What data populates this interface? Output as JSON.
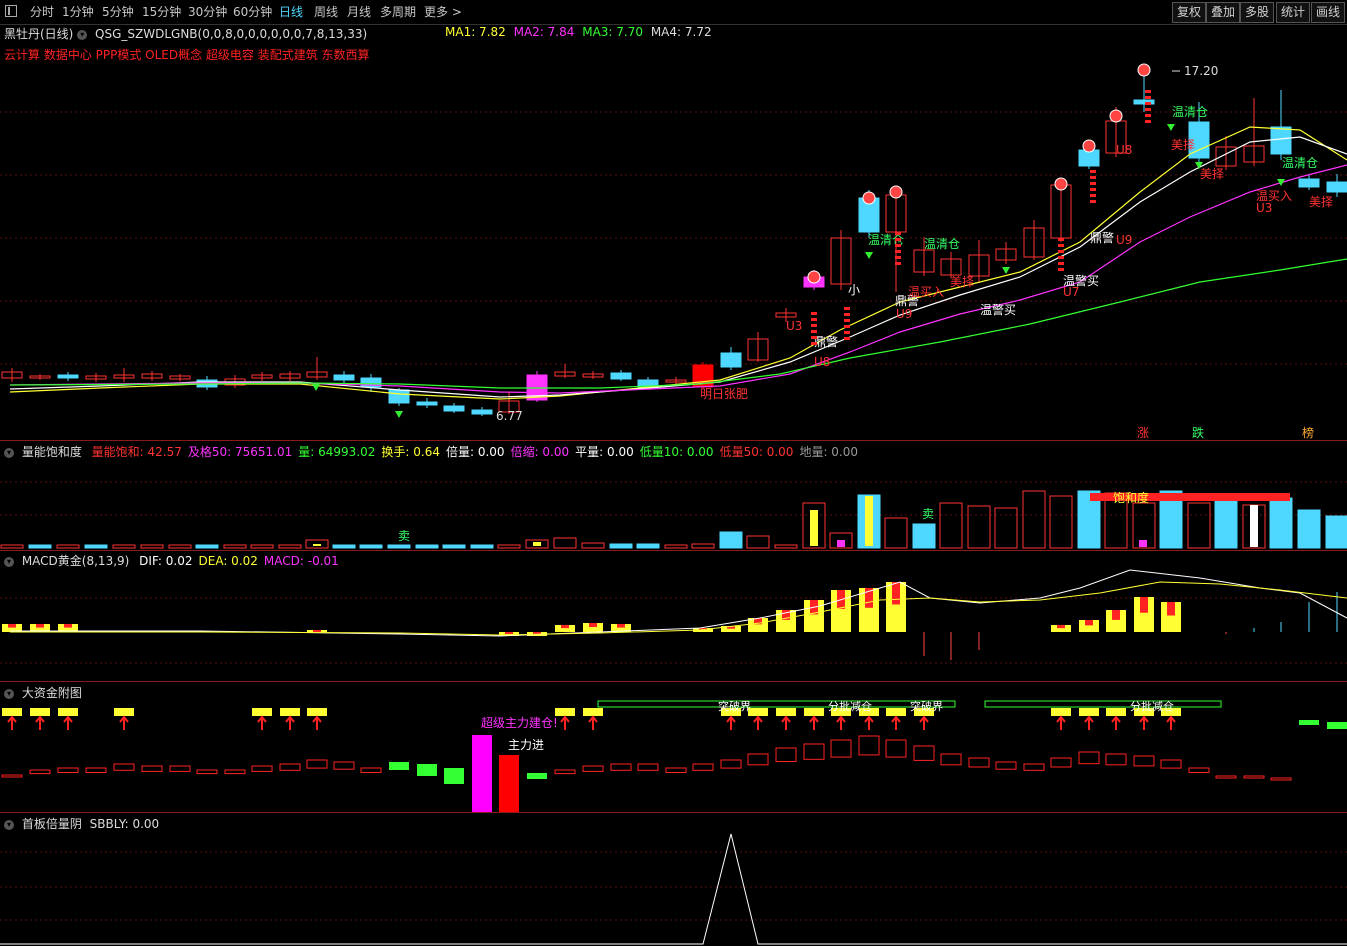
{
  "toolbar": {
    "periods": [
      "分时",
      "1分钟",
      "5分钟",
      "15分钟",
      "30分钟",
      "60分钟",
      "日线",
      "周线",
      "月线",
      "多周期",
      "更多"
    ],
    "active_period": "日线",
    "right_buttons": [
      "复权",
      "叠加",
      "多股",
      "统计",
      "画线"
    ]
  },
  "main": {
    "title": "黑牡丹(日线)",
    "formula": "QSG_SZWDLGNB(0,0,8,0,0,0,0,0,0,7,8,13,33)",
    "ma": [
      {
        "label": "MA1: 7.82",
        "color": "#ffff33"
      },
      {
        "label": "MA2: 7.84",
        "color": "#ff33ff"
      },
      {
        "label": "MA3: 7.70",
        "color": "#33ff33"
      },
      {
        "label": "MA4: 7.72",
        "color": "#dddddd"
      }
    ],
    "concepts": "云计算 数据中心 PPP模式 OLED概念 超级电容 装配式建筑 东数西算",
    "high_price": "17.20",
    "low_price": "6.77",
    "tags": [
      "涨",
      "跌",
      "榜"
    ],
    "annotations": [
      "明日张肥",
      "鼎警",
      "温警买",
      "温清仓",
      "美择",
      "U3",
      "U7",
      "U8",
      "U9",
      "温买入",
      "小"
    ]
  },
  "panels": {
    "volume": {
      "title": "量能饱和度",
      "stats": [
        {
          "label": "量能饱和: 42.57",
          "color": "#ff3333"
        },
        {
          "label": "及格50: 75651.01",
          "color": "#ff33ff"
        },
        {
          "label": "量: 64993.02",
          "color": "#33ff33"
        },
        {
          "label": "换手: 0.64",
          "color": "#ffff33"
        },
        {
          "label": "倍量: 0.00",
          "color": "#ffffff"
        },
        {
          "label": "倍缩: 0.00",
          "color": "#ff33ff"
        },
        {
          "label": "平量: 0.00",
          "color": "#ffffff"
        },
        {
          "label": "低量10: 0.00",
          "color": "#33ff33"
        },
        {
          "label": "低量50: 0.00",
          "color": "#ff3333"
        },
        {
          "label": "地量: 0.00",
          "color": "#999999"
        }
      ],
      "labels": [
        "卖",
        "卖",
        "饱和度"
      ]
    },
    "macd": {
      "title": "MACD黄金(8,13,9)",
      "stats": [
        {
          "label": "DIF: 0.02",
          "color": "#ffffff"
        },
        {
          "label": "DEA: 0.02",
          "color": "#ffff33"
        },
        {
          "label": "MACD: -0.01",
          "color": "#ff33ff"
        }
      ]
    },
    "fund": {
      "title": "大资金附图",
      "labels": [
        "超级主力建仓!",
        "主力进",
        "突破界",
        "分批减仓",
        "突破界",
        "分批减仓"
      ]
    },
    "first": {
      "title": "首板倍量阴",
      "stats": [
        {
          "label": "SBBLY: 0.00",
          "color": "#dddddd"
        }
      ]
    }
  }
}
